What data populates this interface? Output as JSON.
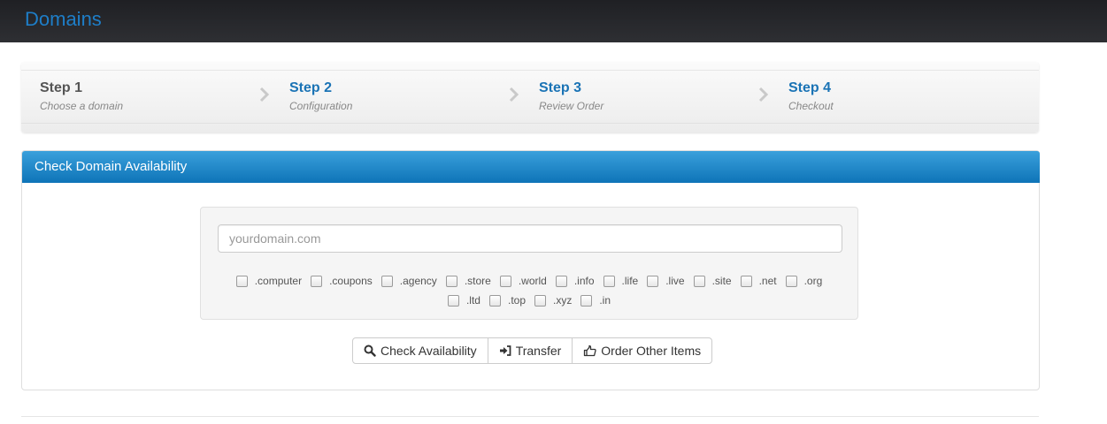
{
  "header": {
    "title": "Domains"
  },
  "steps": [
    {
      "label": "Step 1",
      "desc": "Choose a domain",
      "active": true
    },
    {
      "label": "Step 2",
      "desc": "Configuration",
      "active": false
    },
    {
      "label": "Step 3",
      "desc": "Review Order",
      "active": false
    },
    {
      "label": "Step 4",
      "desc": "Checkout",
      "active": false
    }
  ],
  "panel": {
    "title": "Check Domain Availability",
    "search": {
      "placeholder": "yourdomain.com",
      "value": ""
    },
    "tlds": [
      ".computer",
      ".coupons",
      ".agency",
      ".store",
      ".world",
      ".info",
      ".life",
      ".live",
      ".site",
      ".net",
      ".org",
      ".ltd",
      ".top",
      ".xyz",
      ".in"
    ],
    "buttons": {
      "check": {
        "label": "Check Availability",
        "icon": "search-icon"
      },
      "transfer": {
        "label": "Transfer",
        "icon": "sign-in-icon"
      },
      "order_other": {
        "label": "Order Other Items",
        "icon": "hand-pointer-icon"
      }
    }
  },
  "colors": {
    "accent": "#1a73b5",
    "panel_head": "#1583c6",
    "topbar": "#26272b"
  }
}
